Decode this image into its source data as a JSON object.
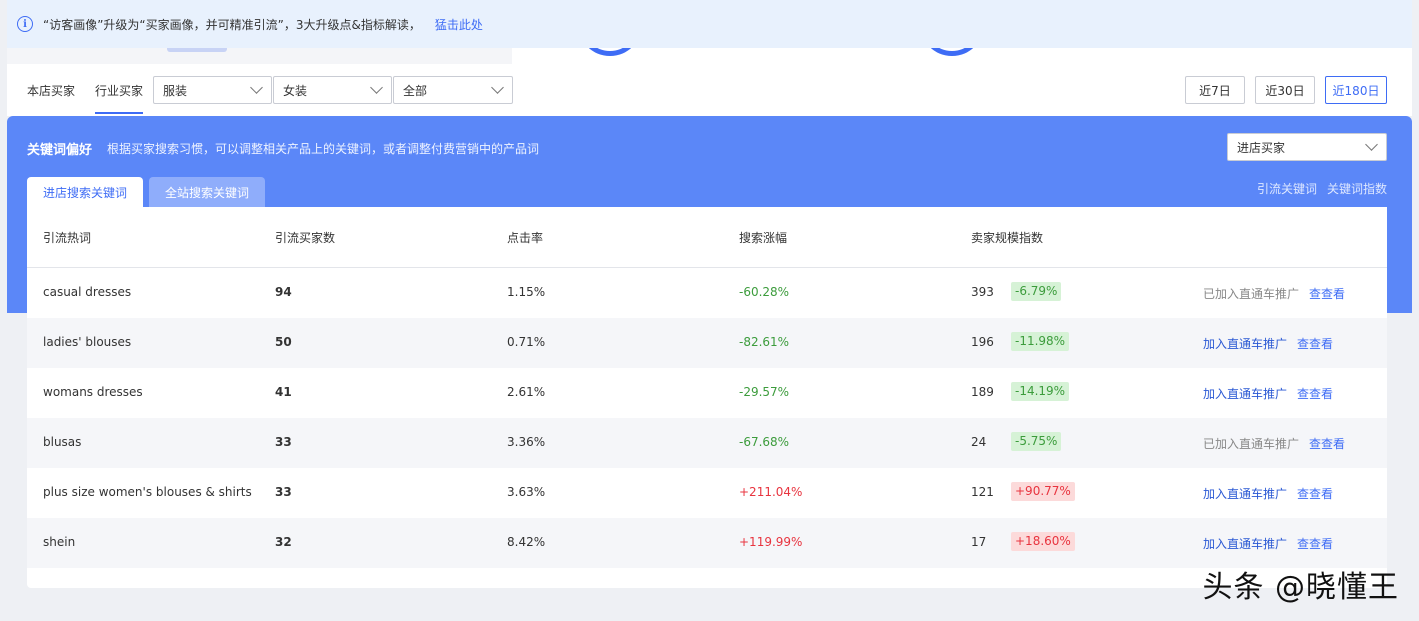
{
  "notice": {
    "text": "“访客画像”升级为“买家画像，并可精准引流”，3大升级点&指标解读，",
    "link": "猛击此处"
  },
  "buyer_tabs": [
    "本店买家",
    "行业买家"
  ],
  "filters": {
    "category": "服装",
    "subcategory": "女装",
    "scope": "全部"
  },
  "periods": [
    "近7日",
    "近30日",
    "近180日"
  ],
  "section": {
    "title": "关键词偏好",
    "desc": "根据买家搜索习惯，可以调整相关产品上的关键词，或者调整付费营销中的产品词",
    "select": "进店买家",
    "tabs": [
      "进店搜索关键词",
      "全站搜索关键词"
    ],
    "links": [
      "引流关键词",
      "关键词指数"
    ]
  },
  "table": {
    "headers": [
      "引流热词",
      "引流买家数",
      "点击率",
      "搜索涨幅",
      "卖家规模指数"
    ],
    "rows": [
      {
        "keyword": "casual dresses",
        "buyers": "94",
        "ctr": "1.15%",
        "growth": "-60.28%",
        "scale": "393",
        "scale_change": "-6.79%",
        "action": "已加入直通车推广",
        "view": "查查看"
      },
      {
        "keyword": "ladies' blouses",
        "buyers": "50",
        "ctr": "0.71%",
        "growth": "-82.61%",
        "scale": "196",
        "scale_change": "-11.98%",
        "action": "加入直通车推广",
        "view": "查查看"
      },
      {
        "keyword": "womans dresses",
        "buyers": "41",
        "ctr": "2.61%",
        "growth": "-29.57%",
        "scale": "189",
        "scale_change": "-14.19%",
        "action": "加入直通车推广",
        "view": "查查看"
      },
      {
        "keyword": "blusas",
        "buyers": "33",
        "ctr": "3.36%",
        "growth": "-67.68%",
        "scale": "24",
        "scale_change": "-5.75%",
        "action": "已加入直通车推广",
        "view": "查查看"
      },
      {
        "keyword": "plus size women's blouses & shirts",
        "buyers": "33",
        "ctr": "3.63%",
        "growth": "+211.04%",
        "scale": "121",
        "scale_change": "+90.77%",
        "action": "加入直通车推广",
        "view": "查查看"
      },
      {
        "keyword": "shein",
        "buyers": "32",
        "ctr": "8.42%",
        "growth": "+119.99%",
        "scale": "17",
        "scale_change": "+18.60%",
        "action": "加入直通车推广",
        "view": "查查看"
      }
    ]
  },
  "watermark": "头条 @晓懂王",
  "colors": {
    "accent": "#3e6cf5",
    "panel": "#5b87f8",
    "down": "#3c9c3c",
    "up": "#e8343f"
  }
}
